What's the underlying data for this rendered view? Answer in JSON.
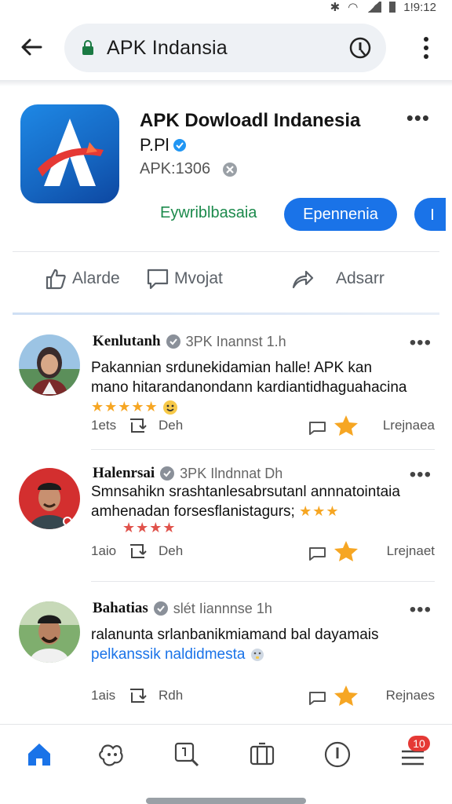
{
  "status_bar": {
    "time": "1!9:12"
  },
  "app_bar": {
    "url_text": "APK Indansia"
  },
  "app_header": {
    "title": "APK Dowloadl Indanesia",
    "developer": "P.Pl",
    "apk_label": "APK:1306",
    "secondary_link": "Eywriblbasaia",
    "primary_button": "Epennenia",
    "more": "•••"
  },
  "actions": {
    "like": "Alarde",
    "comment": "Mvojat",
    "share": "Adsarr"
  },
  "posts": [
    {
      "author": "Kenlutanh",
      "meta": "3PK Inannst 1.h",
      "line1": "Pakannian srdunekidamian halle! APK kan",
      "line2": "mano hitarandanondann kardiantidhaguahacina",
      "stars": "★★★★★",
      "foot_count": "1ets",
      "foot_label": "Deh",
      "foot_right": "Lrejnaea",
      "more": "•••"
    },
    {
      "author": "Halenrsai",
      "meta": "3PK Ilndnnat Dh",
      "line1": "Smnsahikn srashtanlesabrsutanl annnatointaia",
      "line2": "amhenadan forsesflanistagurs;",
      "stars_inline": "★★★",
      "stars_below": "★★★★",
      "foot_count": "1aio",
      "foot_label": "Deh",
      "foot_right": "Lrejnaet",
      "more": "•••"
    },
    {
      "author": "Bahatias",
      "meta": "slét Iiannnse 1h",
      "line1": "ralanunta srlanbanikmiamand bal dayamais",
      "line2": "pelkanssik naldidmesta",
      "foot_count": "1ais",
      "foot_label": "Rdh",
      "foot_right": "Rejnaes",
      "more": "•••"
    }
  ],
  "bottom_nav": {
    "badge": "10"
  },
  "colors": {
    "accent": "#1a73e8",
    "star": "#f6a623",
    "badge": "#e53935",
    "link_green": "#1c8a4c"
  }
}
